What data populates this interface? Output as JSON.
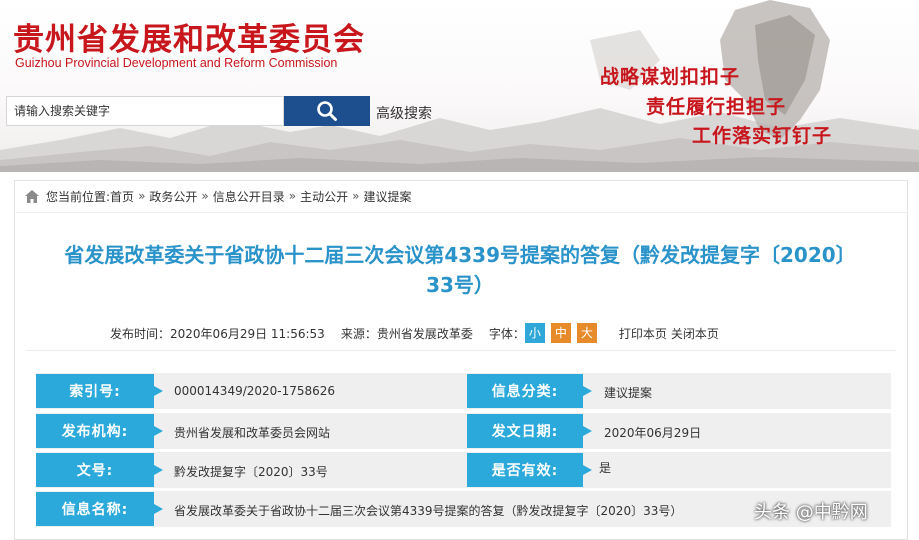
{
  "header": {
    "title": "贵州省发展和改革委员会",
    "subtitle": "Guizhou Provincial Development and Reform Commission",
    "search_placeholder": "请输入搜索关键字",
    "advanced_search": "高级搜索",
    "slogans": [
      "战略谋划扣扣子",
      "责任履行担担子",
      "工作落实钉钉子"
    ],
    "brand_color": "#c8161d"
  },
  "breadcrumb": {
    "prefix": "您当前位置:",
    "items": [
      "首页",
      "政务公开",
      "信息公开目录",
      "主动公开",
      "建议提案"
    ],
    "separator": "»"
  },
  "article": {
    "title_line1": "省发展改革委关于省政协十二届三次会议第4339号提案的答复（黔发改提复字〔2020〕",
    "title_line2": "33号）",
    "title_color": "#2a93c9",
    "publish_time_label": "发布时间：",
    "publish_time": "2020年06月29日 11:56:53",
    "source_label": "来源：",
    "source": "贵州省发展改革委",
    "font_label": "字体：",
    "font_sizes": [
      "小",
      "中",
      "大"
    ],
    "print": "打印本页",
    "close": "关闭本页"
  },
  "info_table": {
    "label_color": "#2ca9db",
    "index_label": "索引号:",
    "index_value": "000014349/2020-1758626",
    "category_label": "信息分类:",
    "category_value": "建议提案",
    "issuer_label": "发布机构:",
    "issuer_value": "贵州省发展和改革委员会网站",
    "date_label": "发文日期:",
    "date_value": "2020年06月29日",
    "docno_label": "文号:",
    "docno_value": "黔发改提复字〔2020〕33号",
    "valid_label": "是否有效:",
    "valid_value": "是",
    "name_label": "信息名称:",
    "name_value": "省发展改革委关于省政协十二届三次会议第4339号提案的答复（黔发改提复字〔2020〕33号）"
  },
  "watermark": "头条 @中黔网"
}
